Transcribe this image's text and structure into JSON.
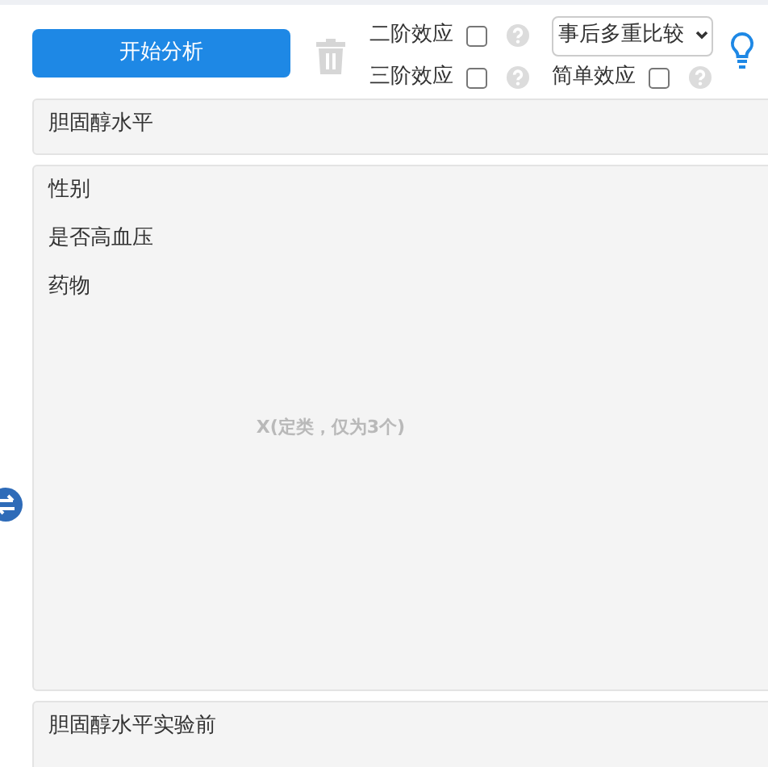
{
  "toolbar": {
    "run_button": "开始分析",
    "options": [
      {
        "label": "二阶效应",
        "checked": false
      },
      {
        "label": "三阶效应",
        "checked": false
      },
      {
        "label": "简单效应",
        "checked": false
      }
    ],
    "select": {
      "value": "事后多重比较"
    }
  },
  "dependent_box": {
    "items": [
      "胆固醇水平"
    ]
  },
  "factor_box": {
    "items": [
      "性别",
      "是否高血压",
      "药物"
    ],
    "placeholder": "X(定类，仅为3个)"
  },
  "covariate_box": {
    "items": [
      "胆固醇水平实验前"
    ]
  }
}
